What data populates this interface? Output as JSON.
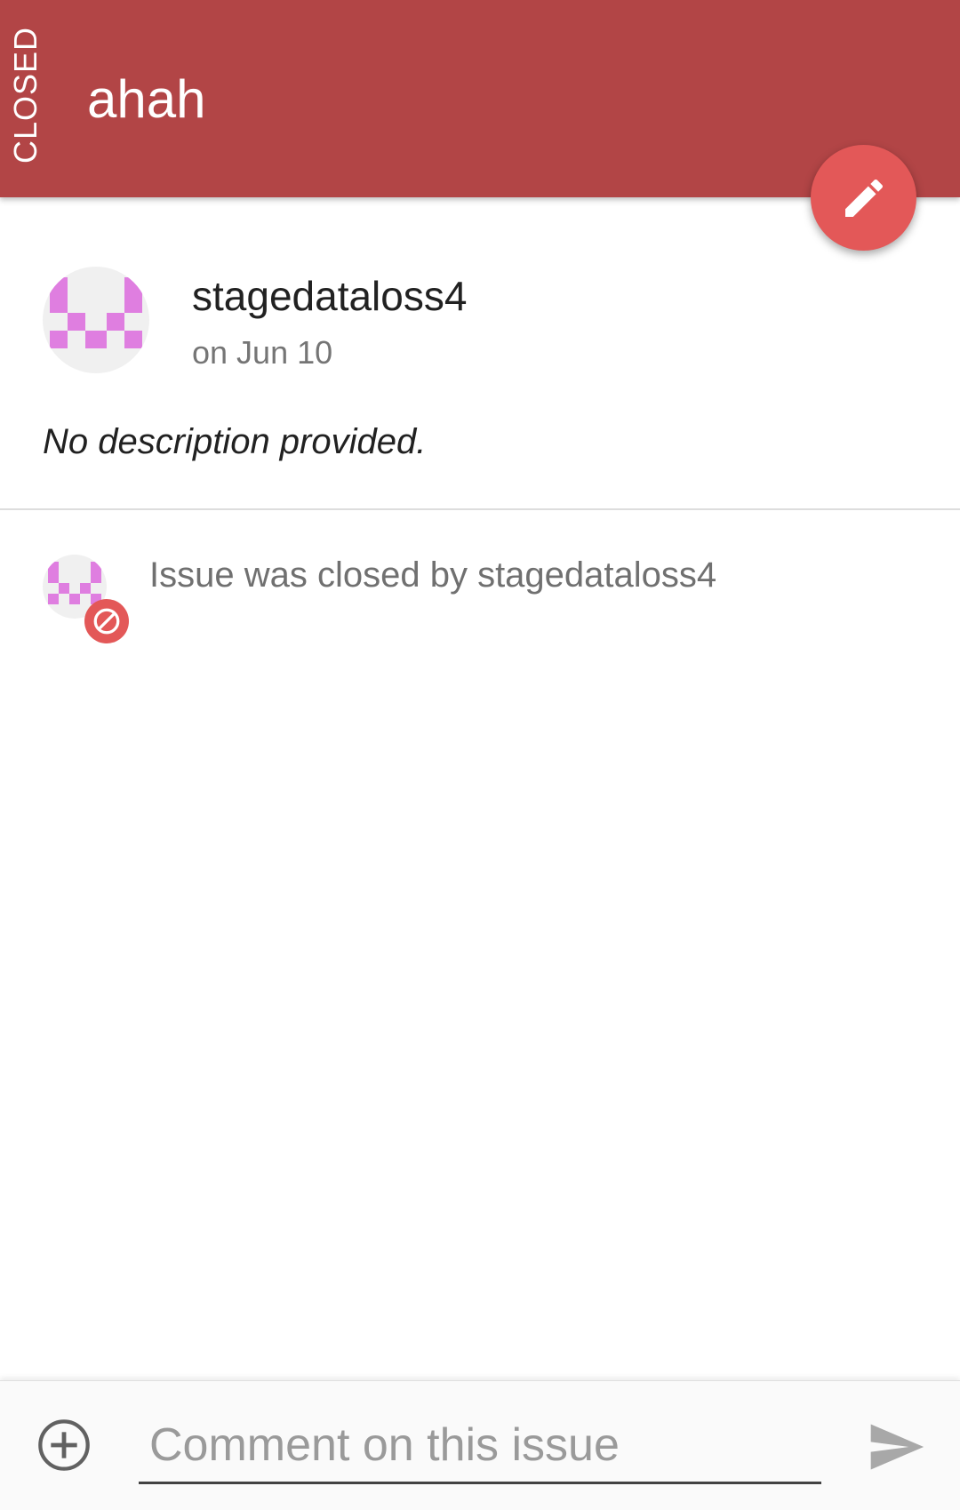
{
  "header": {
    "state": "CLOSED",
    "title": "ahah",
    "background_color": "#b24546",
    "fab_icon": "pencil-icon",
    "fab_color": "#e35858"
  },
  "issue": {
    "author": "stagedataloss4",
    "date": "on Jun 10",
    "description": "No description provided.",
    "avatar_color": "#df7ee0"
  },
  "events": [
    {
      "text": "Issue was closed by stagedataloss4",
      "badge_icon": "closed-circle-icon",
      "badge_color": "#e35858"
    }
  ],
  "comment_bar": {
    "attach_icon": "add-circle-icon",
    "placeholder": "Comment on this issue",
    "value": "",
    "send_icon": "send-icon"
  }
}
